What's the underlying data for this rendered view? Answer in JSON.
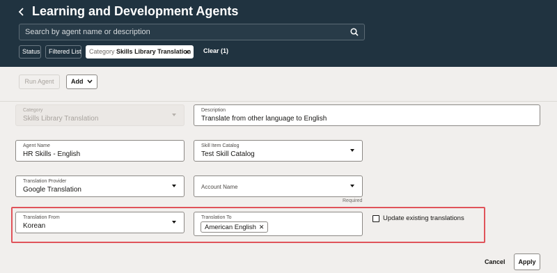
{
  "header": {
    "back_icon": "chevron-left-icon",
    "title": "Learning and Development Agents",
    "search": {
      "placeholder": "Search by agent name or description",
      "value": "",
      "icon": "search-icon"
    },
    "filters": {
      "status_label": "Status",
      "filtered_list_label": "Filtered List",
      "category": {
        "label": "Category",
        "value": "Skills Library Translation",
        "clear_icon": "close-icon"
      },
      "clear_link": "Clear (1)"
    }
  },
  "toolbar": {
    "run_agent_label": "Run Agent",
    "add_label": "Add",
    "add_icon": "chevron-down-icon"
  },
  "form": {
    "category": {
      "label": "Category",
      "value": "Skills Library Translation",
      "disabled": true
    },
    "description": {
      "label": "Description",
      "value": "Translate from other language to English"
    },
    "agent_name": {
      "label": "Agent Name",
      "value": "HR Skills - English"
    },
    "skill_item_catalog": {
      "label": "Skill Item Catalog",
      "value": "Test Skill Catalog"
    },
    "translation_provider": {
      "label": "Translation Provider",
      "value": "Google Translation"
    },
    "account_name": {
      "label": "Account Name",
      "value": "",
      "hint": "Required"
    },
    "translation_from": {
      "label": "Translation From",
      "value": "Korean"
    },
    "translation_to": {
      "label": "Translation To",
      "tags": [
        "American English"
      ]
    },
    "update_existing": {
      "label": "Update existing translations",
      "checked": false
    }
  },
  "footer": {
    "cancel_label": "Cancel",
    "apply_label": "Apply"
  },
  "colors": {
    "header_bg": "#203340",
    "page_bg": "#f1efed",
    "highlight_border": "#e0535a"
  }
}
